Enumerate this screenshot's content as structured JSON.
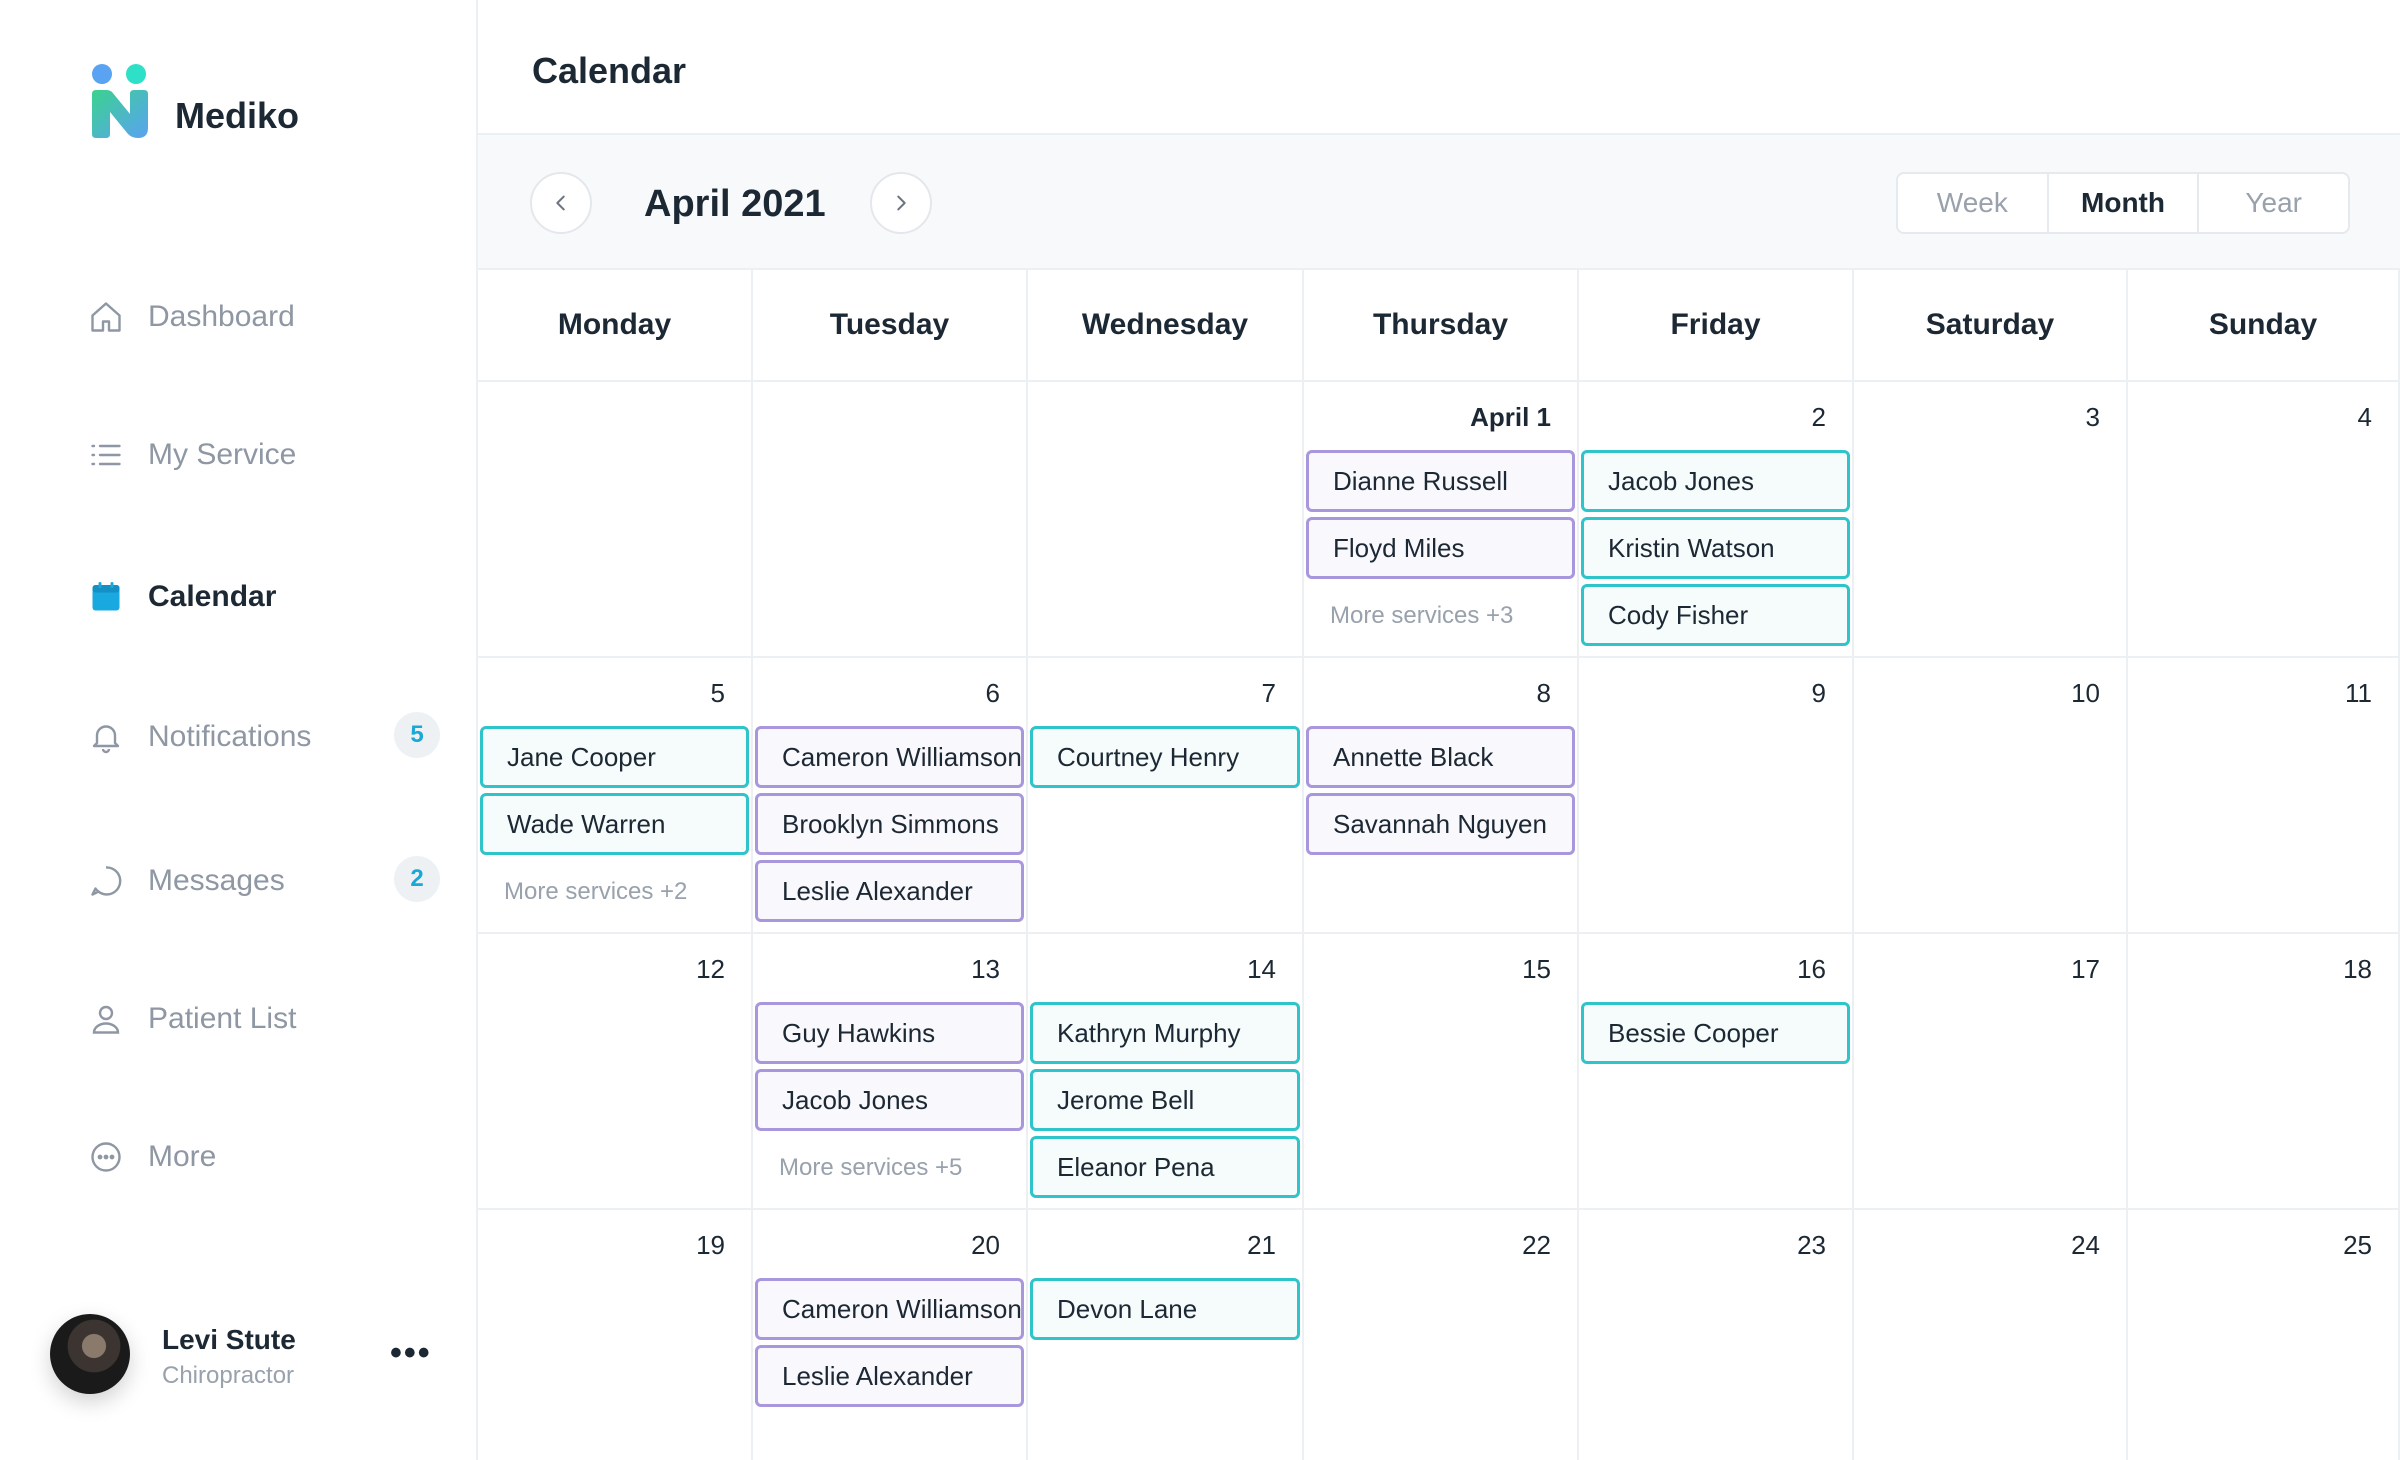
{
  "brand": {
    "name": "Mediko",
    "colors": {
      "blue": "#5aa2f2",
      "teal": "#2ee0c8",
      "green": "#3bd28f"
    }
  },
  "sidebar": {
    "items": [
      {
        "label": "Dashboard",
        "icon": "home-icon",
        "active": false
      },
      {
        "label": "My Service",
        "icon": "list-icon",
        "active": false
      },
      {
        "label": "Calendar",
        "icon": "calendar-icon",
        "active": true
      },
      {
        "label": "Notifications",
        "icon": "bell-icon",
        "active": false,
        "badge": "5"
      },
      {
        "label": "Messages",
        "icon": "chat-icon",
        "active": false,
        "badge": "2"
      },
      {
        "label": "Patient List",
        "icon": "user-icon",
        "active": false
      },
      {
        "label": "More",
        "icon": "more-circle-icon",
        "active": false
      }
    ]
  },
  "profile": {
    "name": "Levi Stute",
    "role": "Chiropractor",
    "menu": "•••"
  },
  "header": {
    "title": "Calendar"
  },
  "toolbar": {
    "month": "April 2021",
    "views": [
      {
        "label": "Week",
        "active": false
      },
      {
        "label": "Month",
        "active": true
      },
      {
        "label": "Year",
        "active": false
      }
    ]
  },
  "calendar": {
    "weekdays": [
      "Monday",
      "Tuesday",
      "Wednesday",
      "Thursday",
      "Friday",
      "Saturday",
      "Sunday"
    ],
    "colors": {
      "teal": "#2ec4c9",
      "purple": "#a897dc"
    },
    "weeks": [
      [
        {
          "day": "",
          "events": []
        },
        {
          "day": "",
          "events": []
        },
        {
          "day": "",
          "events": []
        },
        {
          "day": "April 1",
          "bold": true,
          "events": [
            {
              "name": "Dianne Russell",
              "color": "purple"
            },
            {
              "name": "Floyd Miles",
              "color": "purple"
            }
          ],
          "more": "More services +3"
        },
        {
          "day": "2",
          "events": [
            {
              "name": "Jacob Jones",
              "color": "teal"
            },
            {
              "name": "Kristin Watson",
              "color": "teal"
            },
            {
              "name": "Cody Fisher",
              "color": "teal"
            }
          ]
        },
        {
          "day": "3",
          "events": []
        },
        {
          "day": "4",
          "events": []
        }
      ],
      [
        {
          "day": "5",
          "events": [
            {
              "name": "Jane Cooper",
              "color": "teal"
            },
            {
              "name": "Wade Warren",
              "color": "teal"
            }
          ],
          "more": "More services +2"
        },
        {
          "day": "6",
          "events": [
            {
              "name": "Cameron Williamson",
              "color": "purple"
            },
            {
              "name": "Brooklyn Simmons",
              "color": "purple"
            },
            {
              "name": "Leslie Alexander",
              "color": "purple"
            }
          ]
        },
        {
          "day": "7",
          "events": [
            {
              "name": "Courtney Henry",
              "color": "teal"
            }
          ]
        },
        {
          "day": "8",
          "events": [
            {
              "name": "Annette Black",
              "color": "purple"
            },
            {
              "name": "Savannah Nguyen",
              "color": "purple"
            }
          ]
        },
        {
          "day": "9",
          "events": []
        },
        {
          "day": "10",
          "events": []
        },
        {
          "day": "11",
          "events": []
        }
      ],
      [
        {
          "day": "12",
          "events": []
        },
        {
          "day": "13",
          "events": [
            {
              "name": "Guy Hawkins",
              "color": "purple"
            },
            {
              "name": "Jacob Jones",
              "color": "purple"
            }
          ],
          "more": "More services +5"
        },
        {
          "day": "14",
          "events": [
            {
              "name": "Kathryn Murphy",
              "color": "teal"
            },
            {
              "name": "Jerome Bell",
              "color": "teal"
            },
            {
              "name": "Eleanor Pena",
              "color": "teal"
            }
          ]
        },
        {
          "day": "15",
          "events": []
        },
        {
          "day": "16",
          "events": [
            {
              "name": "Bessie Cooper",
              "color": "teal"
            }
          ]
        },
        {
          "day": "17",
          "events": []
        },
        {
          "day": "18",
          "events": []
        }
      ],
      [
        {
          "day": "19",
          "events": []
        },
        {
          "day": "20",
          "events": [
            {
              "name": "Cameron Williamson",
              "color": "purple"
            },
            {
              "name": "Leslie Alexander",
              "color": "purple"
            }
          ]
        },
        {
          "day": "21",
          "events": [
            {
              "name": "Devon Lane",
              "color": "teal"
            }
          ]
        },
        {
          "day": "22",
          "events": []
        },
        {
          "day": "23",
          "events": []
        },
        {
          "day": "24",
          "events": []
        },
        {
          "day": "25",
          "events": []
        }
      ]
    ]
  }
}
